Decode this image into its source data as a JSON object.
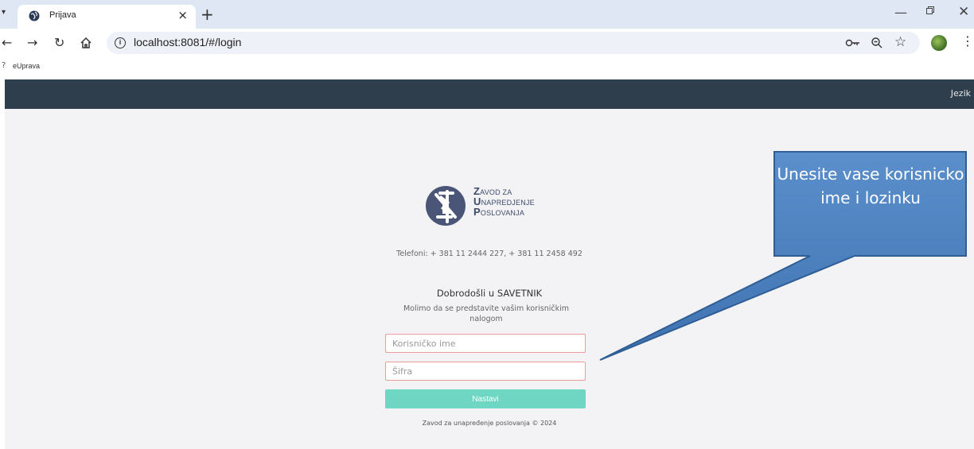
{
  "browser": {
    "tab_title": "Prijava",
    "tab_close": "×",
    "new_tab": "+",
    "url": "localhost:8081/#/login",
    "bookmark_label": "eUprava",
    "window_controls": {
      "minimize": "—",
      "close": "✕"
    },
    "icons": [
      "back-icon",
      "forward-icon",
      "reload-icon",
      "home-icon",
      "info-icon",
      "password-key-icon",
      "zoom-icon",
      "star-icon",
      "profile-avatar",
      "menu-icon"
    ]
  },
  "navbar": {
    "language_label": "Jezik",
    "background": "#2f3e4d"
  },
  "logo": {
    "line1_initial": "Z",
    "line1_rest": "AVOD ZA",
    "line2_initial": "U",
    "line2_rest": "NAPREDJENJE",
    "line3_initial": "P",
    "line3_rest": "OSLOVANJA"
  },
  "contact": {
    "phones": "Telefoni: + 381 11 2444 227, + 381 11 2458 492"
  },
  "login": {
    "welcome": "Dobrodošli u SAVETNIK",
    "subtitle": "Molimo da se predstavite vašim korisničkim nalogom",
    "username_placeholder": "Korisničko ime",
    "password_placeholder": "Šifra",
    "submit_label": "Nastavi",
    "submit_color": "#6fd6c3"
  },
  "footer": {
    "copyright": "Zavod za unapređenje poslovanja © 2024"
  },
  "callout": {
    "text": "Unesite vase korisnicko ime i lozinku",
    "fill": "#4a7ebb"
  }
}
